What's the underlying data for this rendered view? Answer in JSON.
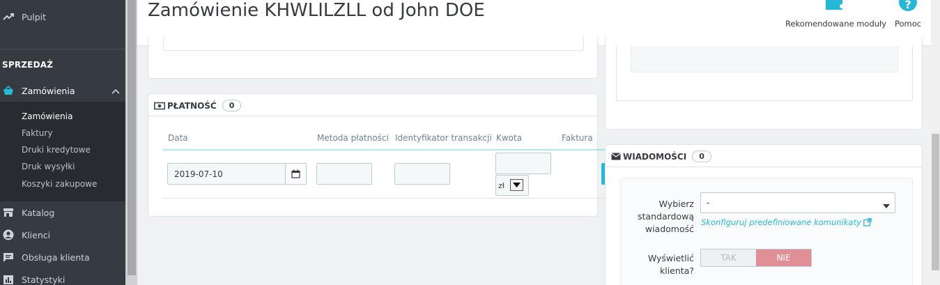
{
  "sidebar": {
    "dashboard_label": "Pulpit",
    "section_label": "SPRZEDAŻ",
    "orders_label": "Zamówienia",
    "sub_items": [
      "Zamówienia",
      "Faktury",
      "Druki kredytowe",
      "Druk wysyłki",
      "Koszyki zakupowe"
    ],
    "catalog_label": "Katalog",
    "customers_label": "Klienci",
    "service_label": "Obsługa klienta",
    "stats_label": "Statystyki"
  },
  "header": {
    "title": "Zamówienie KHWLILZLL od John DOE",
    "recommended_label": "Rekomendowane moduły",
    "help_label": "Pomoc"
  },
  "payment": {
    "title": "PŁATNOŚĆ",
    "count": "0",
    "columns": [
      "Data",
      "Metoda płatności",
      "Identyfikator transakcji",
      "Kwota",
      "Faktura"
    ],
    "date_value": "2019-07-10",
    "currency_value": "zł"
  },
  "messages": {
    "title": "WIADOMOŚCI",
    "count": "0",
    "choose_label": "Wybierz standardową wiadomość",
    "choose_line1": "Wybierz",
    "choose_line2": "standardową",
    "choose_line3": "wiadomość",
    "select_value": "-",
    "configure_link": "Skonfiguruj predefiniowane komunikaty",
    "show_line1": "Wyświetlić",
    "show_line2": "klienta?",
    "toggle_yes": "TAK",
    "toggle_no": "NIE"
  },
  "colors": {
    "accent": "#25b9d7",
    "sidebar_bg": "#363a41",
    "toggle_no_bg": "#e08f95"
  },
  "icons": [
    "trend-icon",
    "basket-icon",
    "chevron-up-icon",
    "store-icon",
    "user-icon",
    "chat-icon",
    "stats-icon",
    "puzzle-icon",
    "help-icon",
    "money-icon",
    "envelope-icon",
    "calendar-icon",
    "external-link-icon",
    "caret-down-icon"
  ]
}
